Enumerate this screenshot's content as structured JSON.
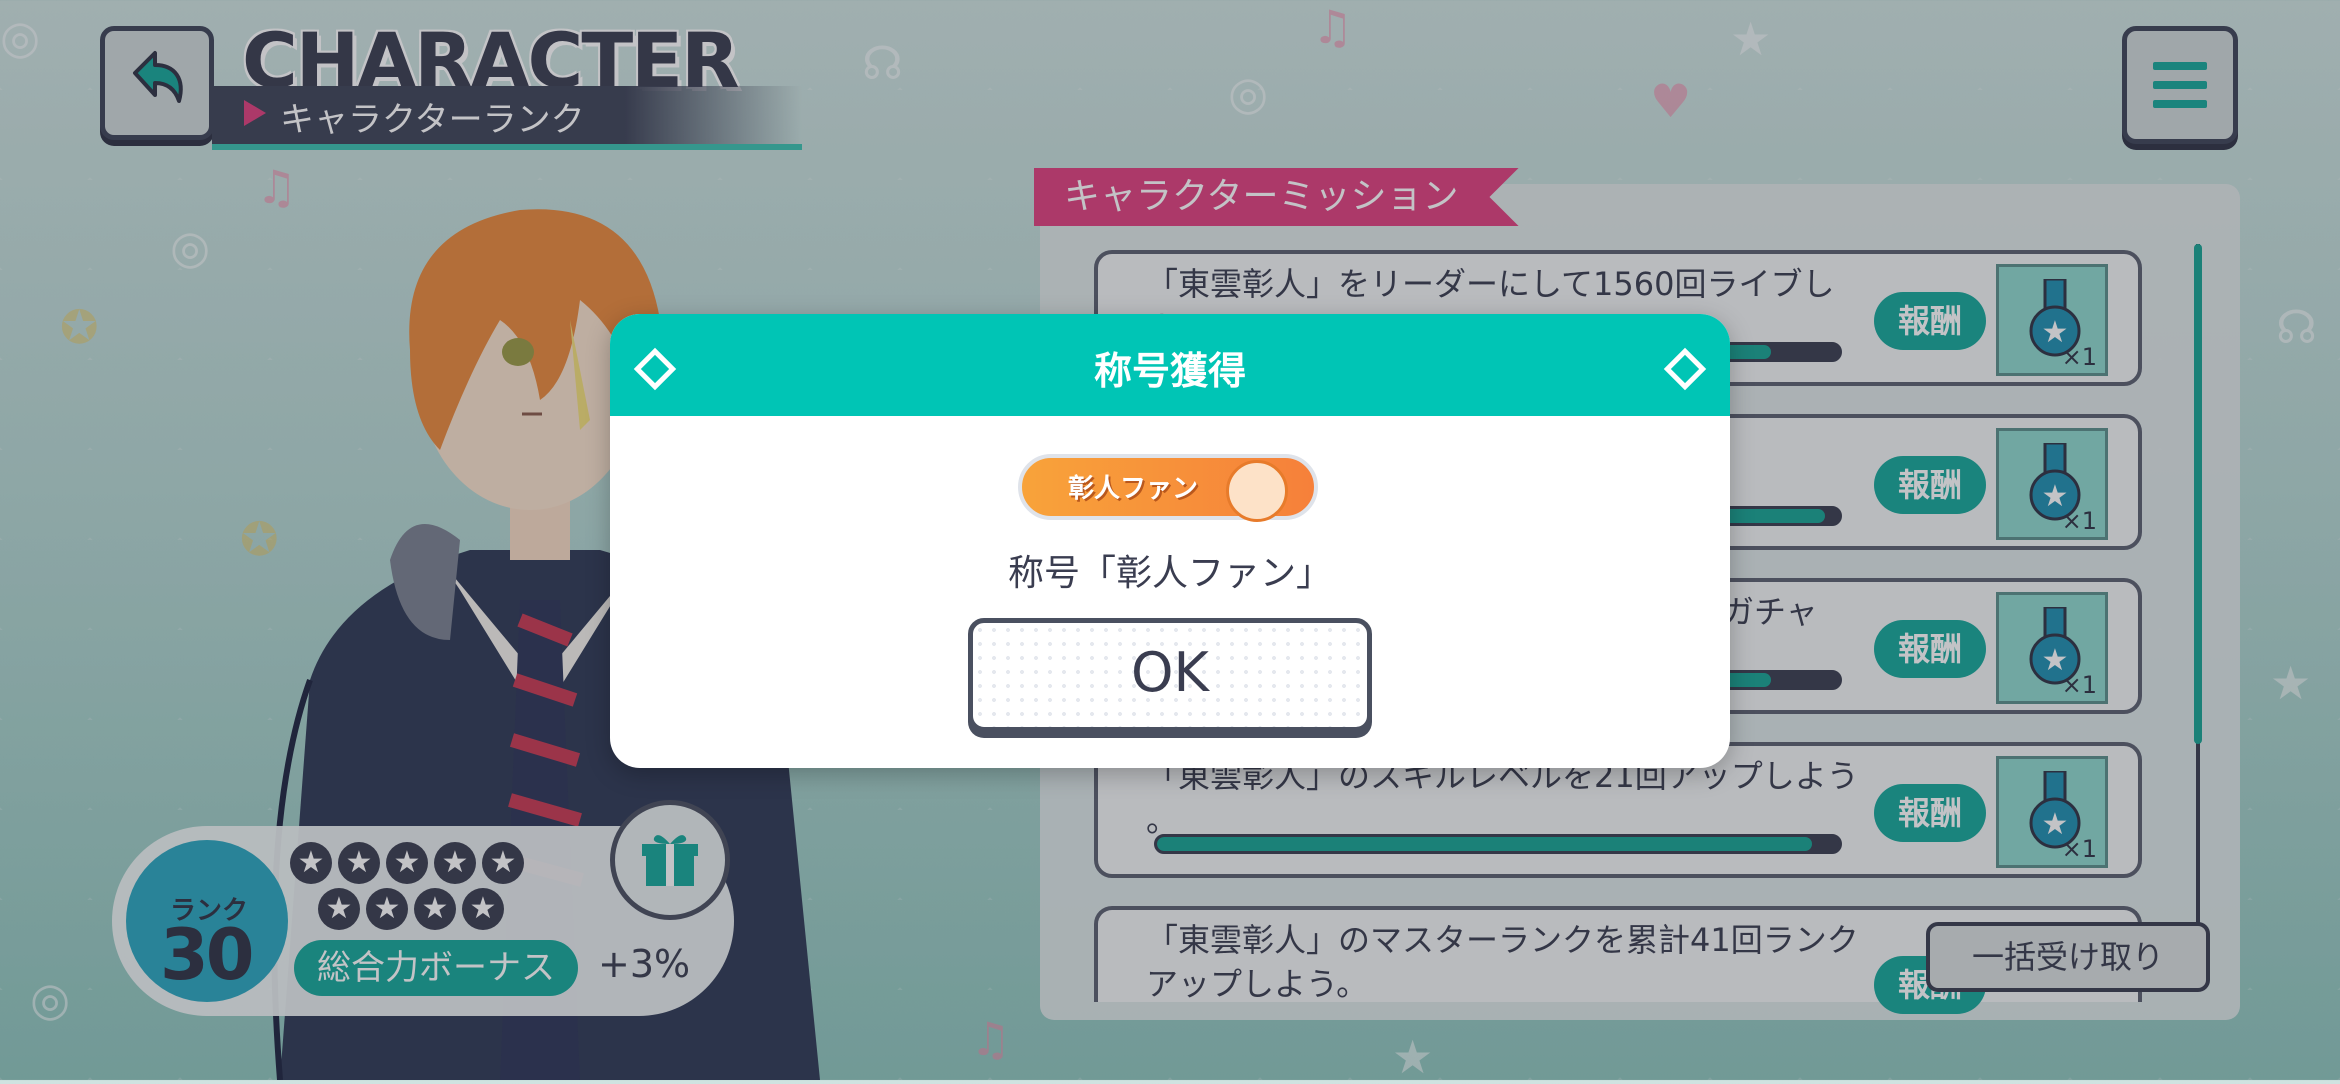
{
  "header": {
    "title_en": "CHARACTER",
    "subtitle_jp": "キャラクターランク",
    "back_icon": "back-arrow-icon",
    "menu_icon": "hamburger-menu-icon"
  },
  "mission_panel": {
    "tab_label": "キャラクターミッション",
    "missions": [
      {
        "text": "「東雲彰人」をリーダーにして1560回ライブしよ\nう",
        "progress": 0.9,
        "reward_label": "報酬",
        "reward_count": "×1"
      },
      {
        "text": "",
        "progress": 0.98,
        "reward_label": "報酬",
        "reward_count": "×1"
      },
      {
        "text": "　　　　　　　　　　　　　　　　　・ガチャ\n　　　　　　　　　　　　　　　　う。",
        "progress": 0.9,
        "reward_label": "報酬",
        "reward_count": "×1"
      },
      {
        "text": "「東雲彰人」のスキルレベルを21回アップしよう\n。",
        "progress": 0.96,
        "reward_label": "報酬",
        "reward_count": "×1"
      },
      {
        "text": "「東雲彰人」のマスターランクを累計41回ランク\nアップしよう。",
        "progress": 0.0,
        "reward_label": "報酬",
        "reward_count": ""
      }
    ],
    "bulk_receive_label": "一括受け取り"
  },
  "rank_card": {
    "rank_label": "ランク",
    "rank_value": "30",
    "stars_row1": [
      "★",
      "★",
      "★",
      "★",
      "★"
    ],
    "stars_row2": [
      "★",
      "★",
      "★",
      "★"
    ],
    "bonus_label": "総合力ボーナス",
    "bonus_value": "+3%",
    "gift_icon": "gift-icon"
  },
  "dialog": {
    "title": "称号獲得",
    "badge_text": "彰人ファン",
    "message": "称号「彰人ファン」",
    "ok_label": "OK"
  },
  "colors": {
    "accent_teal": "#00c5b5",
    "accent_pink": "#e0417e",
    "dark_navy": "#3a3d50"
  }
}
